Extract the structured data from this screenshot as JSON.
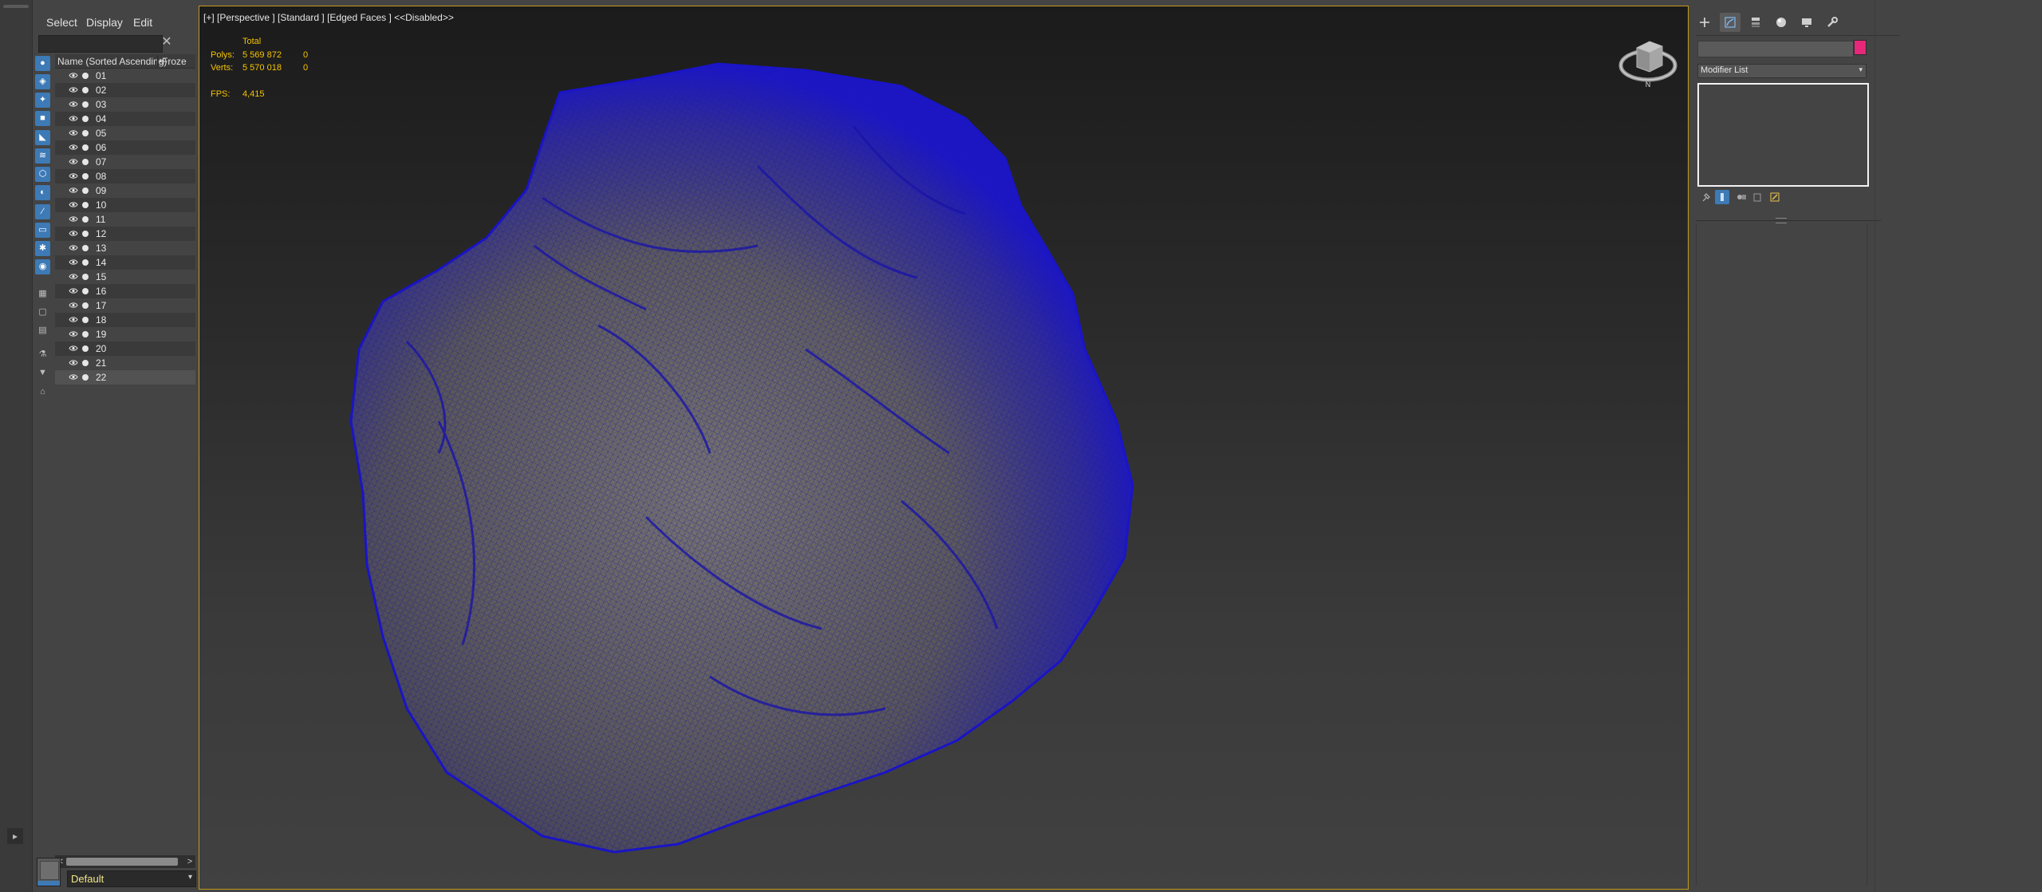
{
  "explorer": {
    "menu": {
      "select": "Select",
      "display": "Display",
      "edit": "Edit"
    },
    "search_placeholder": "",
    "clear_glyph": "✕",
    "header": {
      "name": "Name (Sorted Ascending)",
      "sort_glyph": "▲",
      "frozen": "Froze"
    },
    "items": [
      "01",
      "02",
      "03",
      "04",
      "05",
      "06",
      "07",
      "08",
      "09",
      "10",
      "11",
      "12",
      "13",
      "14",
      "15",
      "16",
      "17",
      "18",
      "19",
      "20",
      "21",
      "22"
    ],
    "scroll": {
      "left": "<",
      "right": ">"
    },
    "layer": {
      "name": "Default",
      "arrow": "▾"
    }
  },
  "viewport": {
    "label": "[+] [Perspective ] [Standard ] [Edged Faces ]  <<Disabled>>",
    "stats": {
      "total_label": "Total",
      "polys_label": "Polys:",
      "polys_value": "5 569 872",
      "polys_sel": "0",
      "verts_label": "Verts:",
      "verts_value": "5 570 018",
      "verts_sel": "0",
      "fps_label": "FPS:",
      "fps_value": "4,415"
    },
    "viewcube_north": "N"
  },
  "command_panel": {
    "object_name": "",
    "object_color": "#e6287a",
    "modifier_list": "Modifier List",
    "modifier_arrow": "▾"
  },
  "colors": {
    "accent": "#3d7ab6",
    "viewport_border": "#c39a1c",
    "stats_text": "#f5c400",
    "wire": "#1a14c8"
  }
}
